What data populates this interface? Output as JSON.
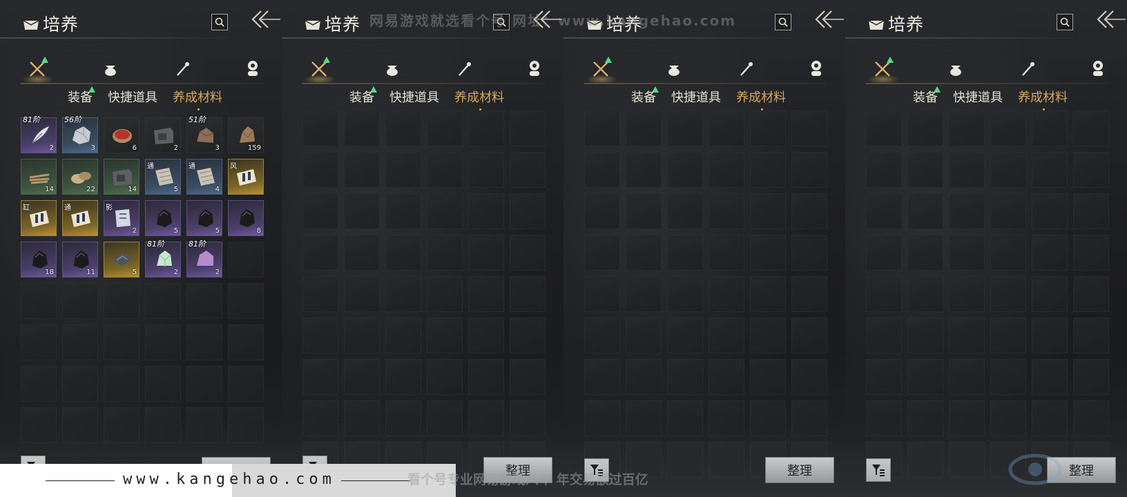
{
  "watermark": {
    "top_text": "网易游戏就选看个号  网址：www.kangehao.com",
    "bottom_url": "www.kangehao.com",
    "bottom_slogan": "看个号专业网易游戏八年 年交易额过百亿"
  },
  "colors": {
    "active_tab": "#d6a85e",
    "upgrade_arrow": "#5fd68a",
    "quality_purple": "#6f5aa0",
    "quality_blue": "#4e6a8c",
    "quality_green": "#4f6e50",
    "quality_gold": "#b89232"
  },
  "panels": [
    {
      "title": "培养",
      "category_icons": [
        "crossed-swords-icon",
        "pouch-icon",
        "scroll-icon",
        "coin-stack-icon"
      ],
      "sub_tabs": [
        {
          "label": "装备",
          "active": false
        },
        {
          "label": "快捷道具",
          "active": false
        },
        {
          "label": "养成材料",
          "active": true
        }
      ],
      "sort_label": "整理",
      "items": [
        {
          "rank": "81阶",
          "qty": "2",
          "quality": "purple",
          "icon": "feather-icon"
        },
        {
          "rank": "56阶",
          "qty": "3",
          "quality": "blue",
          "icon": "ore-icon"
        },
        {
          "rank": "",
          "qty": "6",
          "quality": "",
          "icon": "red-disc-icon"
        },
        {
          "rank": "",
          "qty": "2",
          "quality": "",
          "icon": "stone-block-icon"
        },
        {
          "rank": "51阶",
          "qty": "3",
          "quality": "",
          "icon": "rock-icon"
        },
        {
          "rank": "",
          "qty": "159",
          "quality": "",
          "icon": "crystal-icon"
        },
        {
          "rank": "",
          "qty": "14",
          "quality": "green",
          "icon": "firewood-icon"
        },
        {
          "rank": "",
          "qty": "22",
          "quality": "green",
          "icon": "bread-icon"
        },
        {
          "rank": "",
          "qty": "14",
          "quality": "green",
          "icon": "stone-block-icon"
        },
        {
          "tag": "通",
          "qty": "5",
          "quality": "blue",
          "icon": "paper-stack-icon"
        },
        {
          "tag": "通",
          "qty": "4",
          "quality": "blue",
          "icon": "paper-stack-icon"
        },
        {
          "tag": "风",
          "qty": "",
          "quality": "gold",
          "icon": "scroll-bundle-icon"
        },
        {
          "tag": "缸",
          "qty": "",
          "quality": "gold",
          "icon": "scroll-bundle-icon"
        },
        {
          "tag": "通",
          "qty": "",
          "quality": "gold",
          "icon": "scroll-bundle-icon"
        },
        {
          "tag": "影",
          "qty": "2",
          "quality": "purple",
          "icon": "letter-icon"
        },
        {
          "rank": "",
          "qty": "5",
          "quality": "purple",
          "icon": "black-stone-icon"
        },
        {
          "rank": "",
          "qty": "5",
          "quality": "purple",
          "icon": "black-stone-icon"
        },
        {
          "rank": "",
          "qty": "8",
          "quality": "purple",
          "icon": "black-stone-icon"
        },
        {
          "rank": "",
          "qty": "18",
          "quality": "purple",
          "icon": "black-stone-icon"
        },
        {
          "rank": "",
          "qty": "11",
          "quality": "purple",
          "icon": "black-stone-icon"
        },
        {
          "rank": "",
          "qty": "5",
          "quality": "gold",
          "icon": "map-fragment-icon"
        },
        {
          "rank": "81阶",
          "qty": "2",
          "quality": "purple",
          "icon": "jade-icon"
        },
        {
          "rank": "81阶",
          "qty": "2",
          "quality": "purple",
          "icon": "amethyst-icon"
        }
      ]
    },
    {
      "title": "培养",
      "sub_tabs": [
        {
          "label": "装备",
          "active": false
        },
        {
          "label": "快捷道具",
          "active": false
        },
        {
          "label": "养成材料",
          "active": true
        }
      ],
      "sort_label": "整理",
      "items": []
    },
    {
      "title": "培养",
      "sub_tabs": [
        {
          "label": "装备",
          "active": false
        },
        {
          "label": "快捷道具",
          "active": false
        },
        {
          "label": "养成材料",
          "active": true
        }
      ],
      "sort_label": "整理",
      "items": []
    },
    {
      "title": "培养",
      "sub_tabs": [
        {
          "label": "装备",
          "active": false
        },
        {
          "label": "快捷道具",
          "active": false
        },
        {
          "label": "养成材料",
          "active": true
        }
      ],
      "sort_label": "整理",
      "items": []
    }
  ]
}
